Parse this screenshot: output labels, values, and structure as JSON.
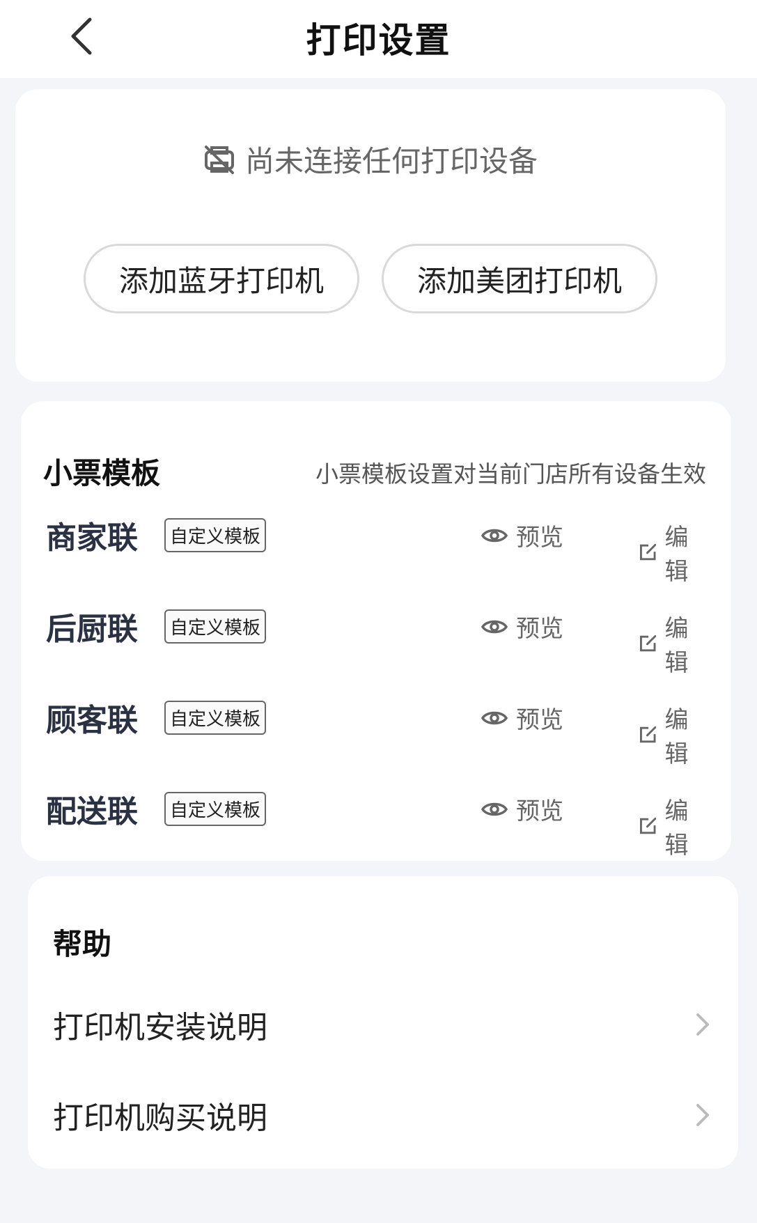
{
  "header": {
    "title": "打印设置"
  },
  "printer_status": {
    "message": "尚未连接任何打印设备",
    "add_bluetooth_label": "添加蓝牙打印机",
    "add_meituan_label": "添加美团打印机"
  },
  "templates": {
    "title": "小票模板",
    "note": "小票模板设置对当前门店所有设备生效",
    "preview_label": "预览",
    "edit_label": "编辑",
    "items": [
      {
        "name": "商家联",
        "tag": "自定义模板"
      },
      {
        "name": "后厨联",
        "tag": "自定义模板"
      },
      {
        "name": "顾客联",
        "tag": "自定义模板"
      },
      {
        "name": "配送联",
        "tag": "自定义模板"
      }
    ]
  },
  "help": {
    "title": "帮助",
    "items": [
      {
        "label": "打印机安装说明"
      },
      {
        "label": "打印机购买说明"
      }
    ]
  }
}
